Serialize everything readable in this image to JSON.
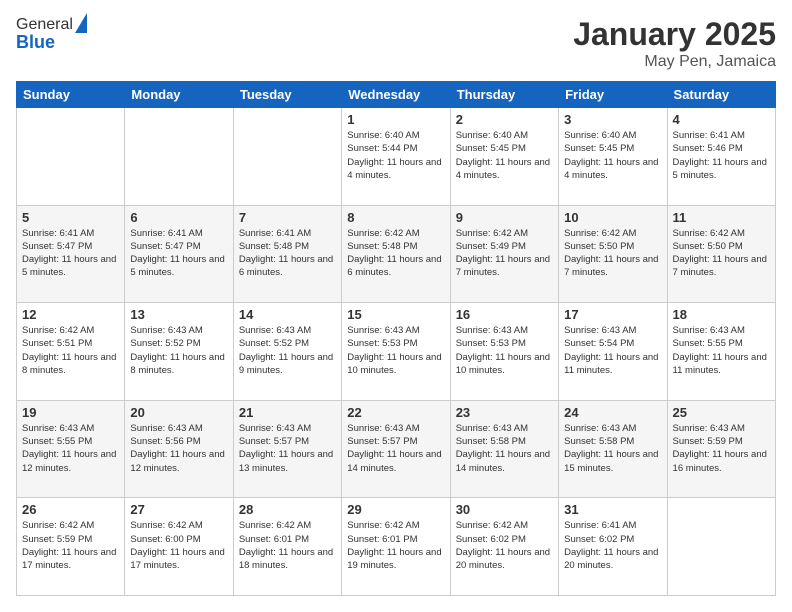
{
  "logo": {
    "general": "General",
    "blue": "Blue"
  },
  "header": {
    "month": "January 2025",
    "location": "May Pen, Jamaica"
  },
  "days_of_week": [
    "Sunday",
    "Monday",
    "Tuesday",
    "Wednesday",
    "Thursday",
    "Friday",
    "Saturday"
  ],
  "weeks": [
    [
      {
        "day": "",
        "info": ""
      },
      {
        "day": "",
        "info": ""
      },
      {
        "day": "",
        "info": ""
      },
      {
        "day": "1",
        "info": "Sunrise: 6:40 AM\nSunset: 5:44 PM\nDaylight: 11 hours and 4 minutes."
      },
      {
        "day": "2",
        "info": "Sunrise: 6:40 AM\nSunset: 5:45 PM\nDaylight: 11 hours and 4 minutes."
      },
      {
        "day": "3",
        "info": "Sunrise: 6:40 AM\nSunset: 5:45 PM\nDaylight: 11 hours and 4 minutes."
      },
      {
        "day": "4",
        "info": "Sunrise: 6:41 AM\nSunset: 5:46 PM\nDaylight: 11 hours and 5 minutes."
      }
    ],
    [
      {
        "day": "5",
        "info": "Sunrise: 6:41 AM\nSunset: 5:47 PM\nDaylight: 11 hours and 5 minutes."
      },
      {
        "day": "6",
        "info": "Sunrise: 6:41 AM\nSunset: 5:47 PM\nDaylight: 11 hours and 5 minutes."
      },
      {
        "day": "7",
        "info": "Sunrise: 6:41 AM\nSunset: 5:48 PM\nDaylight: 11 hours and 6 minutes."
      },
      {
        "day": "8",
        "info": "Sunrise: 6:42 AM\nSunset: 5:48 PM\nDaylight: 11 hours and 6 minutes."
      },
      {
        "day": "9",
        "info": "Sunrise: 6:42 AM\nSunset: 5:49 PM\nDaylight: 11 hours and 7 minutes."
      },
      {
        "day": "10",
        "info": "Sunrise: 6:42 AM\nSunset: 5:50 PM\nDaylight: 11 hours and 7 minutes."
      },
      {
        "day": "11",
        "info": "Sunrise: 6:42 AM\nSunset: 5:50 PM\nDaylight: 11 hours and 7 minutes."
      }
    ],
    [
      {
        "day": "12",
        "info": "Sunrise: 6:42 AM\nSunset: 5:51 PM\nDaylight: 11 hours and 8 minutes."
      },
      {
        "day": "13",
        "info": "Sunrise: 6:43 AM\nSunset: 5:52 PM\nDaylight: 11 hours and 8 minutes."
      },
      {
        "day": "14",
        "info": "Sunrise: 6:43 AM\nSunset: 5:52 PM\nDaylight: 11 hours and 9 minutes."
      },
      {
        "day": "15",
        "info": "Sunrise: 6:43 AM\nSunset: 5:53 PM\nDaylight: 11 hours and 10 minutes."
      },
      {
        "day": "16",
        "info": "Sunrise: 6:43 AM\nSunset: 5:53 PM\nDaylight: 11 hours and 10 minutes."
      },
      {
        "day": "17",
        "info": "Sunrise: 6:43 AM\nSunset: 5:54 PM\nDaylight: 11 hours and 11 minutes."
      },
      {
        "day": "18",
        "info": "Sunrise: 6:43 AM\nSunset: 5:55 PM\nDaylight: 11 hours and 11 minutes."
      }
    ],
    [
      {
        "day": "19",
        "info": "Sunrise: 6:43 AM\nSunset: 5:55 PM\nDaylight: 11 hours and 12 minutes."
      },
      {
        "day": "20",
        "info": "Sunrise: 6:43 AM\nSunset: 5:56 PM\nDaylight: 11 hours and 12 minutes."
      },
      {
        "day": "21",
        "info": "Sunrise: 6:43 AM\nSunset: 5:57 PM\nDaylight: 11 hours and 13 minutes."
      },
      {
        "day": "22",
        "info": "Sunrise: 6:43 AM\nSunset: 5:57 PM\nDaylight: 11 hours and 14 minutes."
      },
      {
        "day": "23",
        "info": "Sunrise: 6:43 AM\nSunset: 5:58 PM\nDaylight: 11 hours and 14 minutes."
      },
      {
        "day": "24",
        "info": "Sunrise: 6:43 AM\nSunset: 5:58 PM\nDaylight: 11 hours and 15 minutes."
      },
      {
        "day": "25",
        "info": "Sunrise: 6:43 AM\nSunset: 5:59 PM\nDaylight: 11 hours and 16 minutes."
      }
    ],
    [
      {
        "day": "26",
        "info": "Sunrise: 6:42 AM\nSunset: 5:59 PM\nDaylight: 11 hours and 17 minutes."
      },
      {
        "day": "27",
        "info": "Sunrise: 6:42 AM\nSunset: 6:00 PM\nDaylight: 11 hours and 17 minutes."
      },
      {
        "day": "28",
        "info": "Sunrise: 6:42 AM\nSunset: 6:01 PM\nDaylight: 11 hours and 18 minutes."
      },
      {
        "day": "29",
        "info": "Sunrise: 6:42 AM\nSunset: 6:01 PM\nDaylight: 11 hours and 19 minutes."
      },
      {
        "day": "30",
        "info": "Sunrise: 6:42 AM\nSunset: 6:02 PM\nDaylight: 11 hours and 20 minutes."
      },
      {
        "day": "31",
        "info": "Sunrise: 6:41 AM\nSunset: 6:02 PM\nDaylight: 11 hours and 20 minutes."
      },
      {
        "day": "",
        "info": ""
      }
    ]
  ]
}
